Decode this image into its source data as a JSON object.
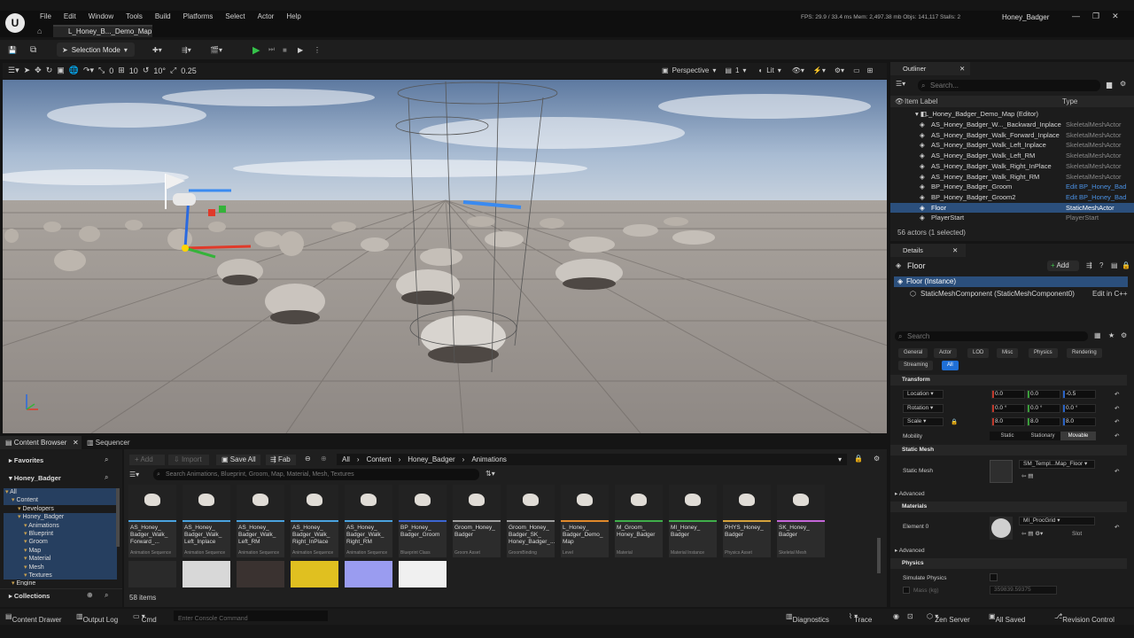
{
  "window": {
    "menu": [
      "File",
      "Edit",
      "Window",
      "Tools",
      "Build",
      "Platforms",
      "Select",
      "Actor",
      "Help"
    ],
    "map_tab": "L_Honey_B..._Demo_Map",
    "stats": "FPS: 29.9 / 33.4 ms  Mem: 2,497.38 mb  Objs: 141,117  Stalls: 2",
    "project": "Honey_Badger",
    "logo": "U"
  },
  "toolbar": {
    "selection_mode": "Selection Mode"
  },
  "viewport_toolbar": {
    "snap_translate": "10",
    "snap_rotate": "10°",
    "snap_scale": "0.25",
    "angle_zero": "0",
    "perspective": "Perspective",
    "lit": "Lit",
    "camera_speed": "1"
  },
  "outliner": {
    "tab": "Outliner",
    "search_placeholder": "Search...",
    "col_label": "Item Label",
    "col_type": "Type",
    "root": "L_Honey_Badger_Demo_Map (Editor)",
    "items": [
      {
        "name": "AS_Honey_Badger_W..._Backward_Inplace",
        "type": "SkeletalMeshActor"
      },
      {
        "name": "AS_Honey_Badger_Walk_Forward_Inplace",
        "type": "SkeletalMeshActor"
      },
      {
        "name": "AS_Honey_Badger_Walk_Left_Inplace",
        "type": "SkeletalMeshActor"
      },
      {
        "name": "AS_Honey_Badger_Walk_Left_RM",
        "type": "SkeletalMeshActor"
      },
      {
        "name": "AS_Honey_Badger_Walk_Right_InPlace",
        "type": "SkeletalMeshActor"
      },
      {
        "name": "AS_Honey_Badger_Walk_Right_RM",
        "type": "SkeletalMeshActor"
      },
      {
        "name": "BP_Honey_Badger_Groom",
        "type": "Edit BP_Honey_Bad"
      },
      {
        "name": "BP_Honey_Badger_Groom2",
        "type": "Edit BP_Honey_Bad"
      },
      {
        "name": "Floor",
        "type": "StaticMeshActor"
      },
      {
        "name": "PlayerStart",
        "type": "PlayerStart"
      }
    ],
    "footer": "56 actors (1 selected)"
  },
  "details": {
    "tab": "Details",
    "actor_name": "Floor",
    "add_label": "Add",
    "instance": "Floor (Instance)",
    "component": "StaticMeshComponent (StaticMeshComponent0)",
    "edit_cpp": "Edit in C++",
    "search_placeholder": "Search",
    "filters": [
      "General",
      "Actor",
      "LOD",
      "Misc",
      "Physics",
      "Rendering",
      "Streaming",
      "All"
    ],
    "transform": {
      "title": "Transform",
      "location": {
        "label": "Location",
        "x": "0.0",
        "y": "0.0",
        "z": "-0.5"
      },
      "rotation": {
        "label": "Rotation",
        "x": "0.0 °",
        "y": "0.0 °",
        "z": "0.0 °"
      },
      "scale": {
        "label": "Scale",
        "x": "8.0",
        "y": "8.0",
        "z": "8.0"
      },
      "mobility": {
        "label": "Mobility",
        "options": [
          "Static",
          "Stationary",
          "Movable"
        ],
        "selected": "Movable"
      }
    },
    "static_mesh": {
      "title": "Static Mesh",
      "label": "Static Mesh",
      "value": "SM_Templ...Map_Floor"
    },
    "advanced": "Advanced",
    "materials": {
      "title": "Materials",
      "label": "Element 0",
      "value": "MI_ProcGrid",
      "slot": "Slot"
    },
    "physics": {
      "title": "Physics",
      "simulate": "Simulate Physics",
      "mass_label": "Mass (kg)",
      "mass_value": "359839.59375"
    }
  },
  "content_browser": {
    "tab": "Content Browser",
    "seq_tab": "Sequencer",
    "favorites": "Favorites",
    "project": "Honey_Badger",
    "tree": [
      {
        "name": "All",
        "indent": 0
      },
      {
        "name": "Content",
        "indent": 1
      },
      {
        "name": "Developers",
        "indent": 2
      },
      {
        "name": "Honey_Badger",
        "indent": 2
      },
      {
        "name": "Animations",
        "indent": 3
      },
      {
        "name": "Blueprint",
        "indent": 3
      },
      {
        "name": "Groom",
        "indent": 3
      },
      {
        "name": "Map",
        "indent": 3
      },
      {
        "name": "Material",
        "indent": 3
      },
      {
        "name": "Mesh",
        "indent": 3
      },
      {
        "name": "Textures",
        "indent": 3
      },
      {
        "name": "Engine",
        "indent": 1
      }
    ],
    "collections": "Collections",
    "add": "Add",
    "import": "Import",
    "save_all": "Save All",
    "fab": "Fab",
    "path": [
      "All",
      "Content",
      "Honey_Badger",
      "Animations"
    ],
    "search_placeholder": "Search Animations, Blueprint, Groom, Map, Material, Mesh, Textures",
    "items_count": "58 items",
    "assets": [
      {
        "name": "AS_Honey_ Badger_Walk_ Forward_...",
        "type": "Animation Sequence",
        "color": "#4aa3df"
      },
      {
        "name": "AS_Honey_ Badger_Walk_ Left_Inplace",
        "type": "Animation Sequence",
        "color": "#4aa3df"
      },
      {
        "name": "AS_Honey_ Badger_Walk_ Left_RM",
        "type": "Animation Sequence",
        "color": "#4aa3df"
      },
      {
        "name": "AS_Honey_ Badger_Walk_ Right_InPlace",
        "type": "Animation Sequence",
        "color": "#4aa3df"
      },
      {
        "name": "AS_Honey_ Badger_Walk_ Right_RM",
        "type": "Animation Sequence",
        "color": "#4aa3df"
      },
      {
        "name": "BP_Honey_ Badger_Groom",
        "type": "Blueprint Class",
        "color": "#3c66d1"
      },
      {
        "name": "Groom_Honey_ Badger",
        "type": "Groom Asset",
        "color": "#a0a0a0"
      },
      {
        "name": "Groom_Honey_ Badger_SK_ Honey_Badger_...",
        "type": "GroomBinding",
        "color": "#a0a0a0"
      },
      {
        "name": "L_Honey_ Badger_Demo_ Map",
        "type": "Level",
        "color": "#e0892b"
      },
      {
        "name": "M_Groom_ Honey_Badger",
        "type": "Material",
        "color": "#3fae4a"
      },
      {
        "name": "MI_Honey_ Badger",
        "type": "Material Instance",
        "color": "#3fae4a"
      },
      {
        "name": "PHYS_Honey_ Badger",
        "type": "Physics Asset",
        "color": "#d4a23c"
      },
      {
        "name": "SK_Honey_ Badger",
        "type": "Skeletal Mesh",
        "color": "#c466d8"
      }
    ]
  },
  "statusbar": {
    "content_drawer": "Content Drawer",
    "output_log": "Output Log",
    "cmd": "Cmd",
    "console_placeholder": "Enter Console Command",
    "diagnostics": "Diagnostics",
    "trace": "Trace",
    "zen": "Zen Server",
    "saved": "All Saved",
    "revision": "Revision Control"
  }
}
